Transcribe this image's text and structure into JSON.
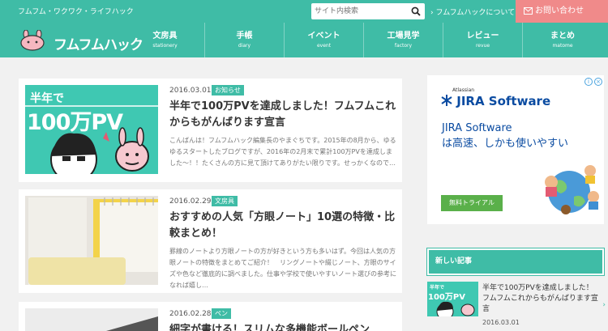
{
  "header": {
    "tagline": "フムフム・ワクワク・ライフハック",
    "search_placeholder": "サイト内検索",
    "about_label": "フムフムハックについて",
    "contact_label": "お問い合わせ",
    "logo_text": "フムフムハック"
  },
  "nav": [
    {
      "jp": "文房具",
      "en": "stationery"
    },
    {
      "jp": "手帳",
      "en": "diary"
    },
    {
      "jp": "イベント",
      "en": "event"
    },
    {
      "jp": "工場見学",
      "en": "factory"
    },
    {
      "jp": "レビュー",
      "en": "revue"
    },
    {
      "jp": "まとめ",
      "en": "matome"
    }
  ],
  "posts": [
    {
      "date": "2016.03.01",
      "category": "お知らせ",
      "title": "半年で100万PVを達成しました！フムフムこれからもがんばります宣言",
      "excerpt": "こんばんは！フムフムハック編集長のやまぐちです。2015年の8月から、ゆるゆるスタートしたブログですが、2016年の2月末で累計100万PVを達成しました〜！！たくさんの方に見て頂けてありがたい限りです。せっかくなので…",
      "thumb_text_1": "半年で",
      "thumb_text_2": "100万PV"
    },
    {
      "date": "2016.02.29",
      "category": "文房具",
      "title": "おすすめの人気「方眼ノート」10選の特徴・比較まとめ！",
      "excerpt": "罫線のノートより方眼ノートの方が好きという方も多いはず。今回は人気の方眼ノートの特徴をまとめてご紹介！　リングノートや綴じノート、方眼のサイズや色など徹底的に調べました。仕事や学校で使いやすいノート選びの参考になれば嬉し…"
    },
    {
      "date": "2016.02.28",
      "category": "ペン",
      "title": "細字が書ける！スリムな多機能ボールペン"
    }
  ],
  "ad": {
    "atlassian": "Atlassian",
    "brand": "JIRA Software",
    "headline_1": "JIRA Software",
    "headline_2": "は高速、しかも使いやすい",
    "button": "無料トライアル"
  },
  "sidebar": {
    "recent_heading": "新しい記事",
    "recent_title": "半年で100万PVを達成しました！フムフムこれからもがんばります宣言",
    "recent_date": "2016.03.01",
    "arrow": "›"
  },
  "colors": {
    "primary": "#3fbca6",
    "contact": "#f08a8a",
    "ad_blue": "#0a4ba1",
    "ad_green": "#5ab04a"
  }
}
